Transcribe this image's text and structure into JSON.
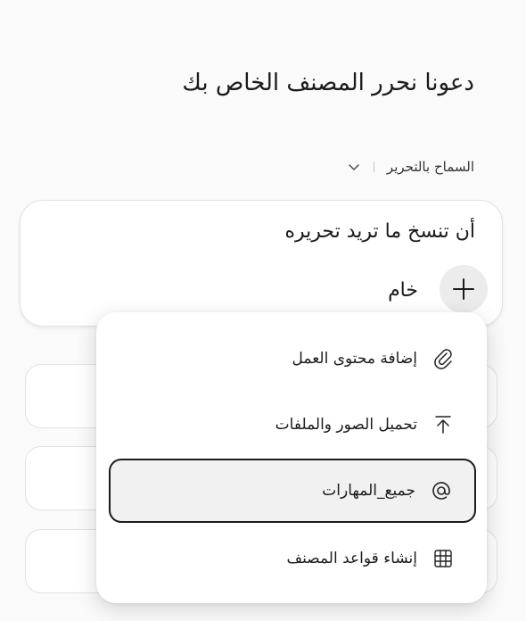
{
  "heading": "دعونا نحرر المصنف الخاص بك",
  "permission": {
    "label": "السماح بالتحرير",
    "dropdown_icon": "chevron-down-icon"
  },
  "composer": {
    "prompt_text": "أن تنسخ ما تريد تحريره",
    "mode_label": "خام",
    "add_icon": "plus-icon"
  },
  "menu": {
    "items": [
      {
        "label": "إضافة محتوى العمل",
        "icon": "paperclip-icon"
      },
      {
        "label": "تحميل الصور والملفات",
        "icon": "upload-icon"
      },
      {
        "label": "جميع_المهارات",
        "icon": "at-icon",
        "selected": true
      },
      {
        "label": "إنشاء قواعد المصنف",
        "icon": "grid-icon"
      }
    ]
  },
  "colors": {
    "background": "#fafafa",
    "card": "#ffffff",
    "border": "#e2e2e2",
    "text": "#1b1b1b",
    "selected_bg": "#f1f1f1"
  }
}
